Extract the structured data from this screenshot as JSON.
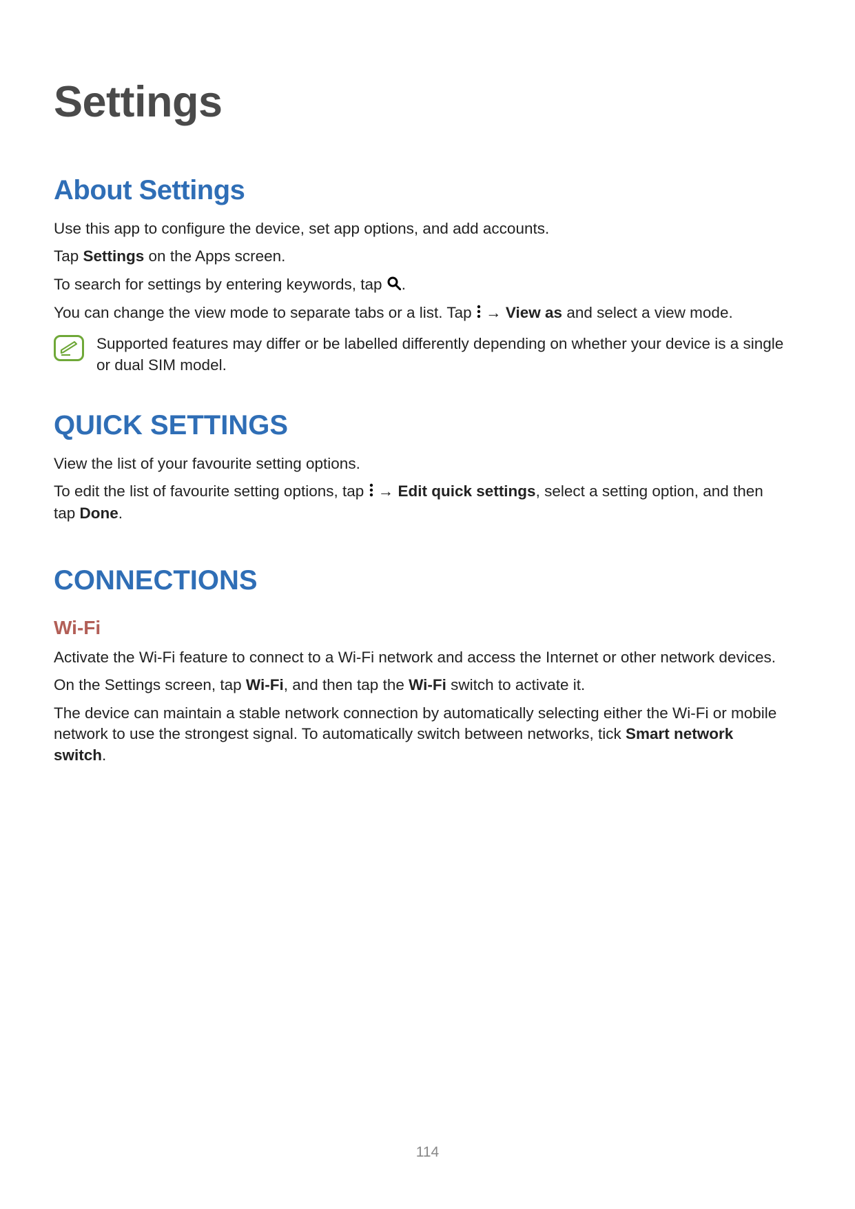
{
  "title": "Settings",
  "about": {
    "heading": "About Settings",
    "p1": "Use this app to configure the device, set app options, and add accounts.",
    "p2a": "Tap ",
    "p2b": "Settings",
    "p2c": " on the Apps screen.",
    "p3a": "To search for settings by entering keywords, tap ",
    "p3b": ".",
    "p4a": "You can change the view mode to separate tabs or a list. Tap ",
    "p4arrow": " → ",
    "p4b": "View as",
    "p4c": " and select a view mode.",
    "note": "Supported features may differ or be labelled differently depending on whether your device is a single or dual SIM model."
  },
  "quick": {
    "heading": "QUICK SETTINGS",
    "p1": "View the list of your favourite setting options.",
    "p2a": "To edit the list of favourite setting options, tap ",
    "p2arrow": " → ",
    "p2b": "Edit quick settings",
    "p2c": ", select a setting option, and then tap ",
    "p2d": "Done",
    "p2e": "."
  },
  "connections": {
    "heading": "CONNECTIONS",
    "wifi": {
      "heading": "Wi-Fi",
      "p1": "Activate the Wi-Fi feature to connect to a Wi-Fi network and access the Internet or other network devices.",
      "p2a": "On the Settings screen, tap ",
      "p2b": "Wi-Fi",
      "p2c": ", and then tap the ",
      "p2d": "Wi-Fi",
      "p2e": " switch to activate it.",
      "p3a": "The device can maintain a stable network connection by automatically selecting either the Wi-Fi or mobile network to use the strongest signal. To automatically switch between networks, tick ",
      "p3b": "Smart network switch",
      "p3c": "."
    }
  },
  "page_number": "114"
}
